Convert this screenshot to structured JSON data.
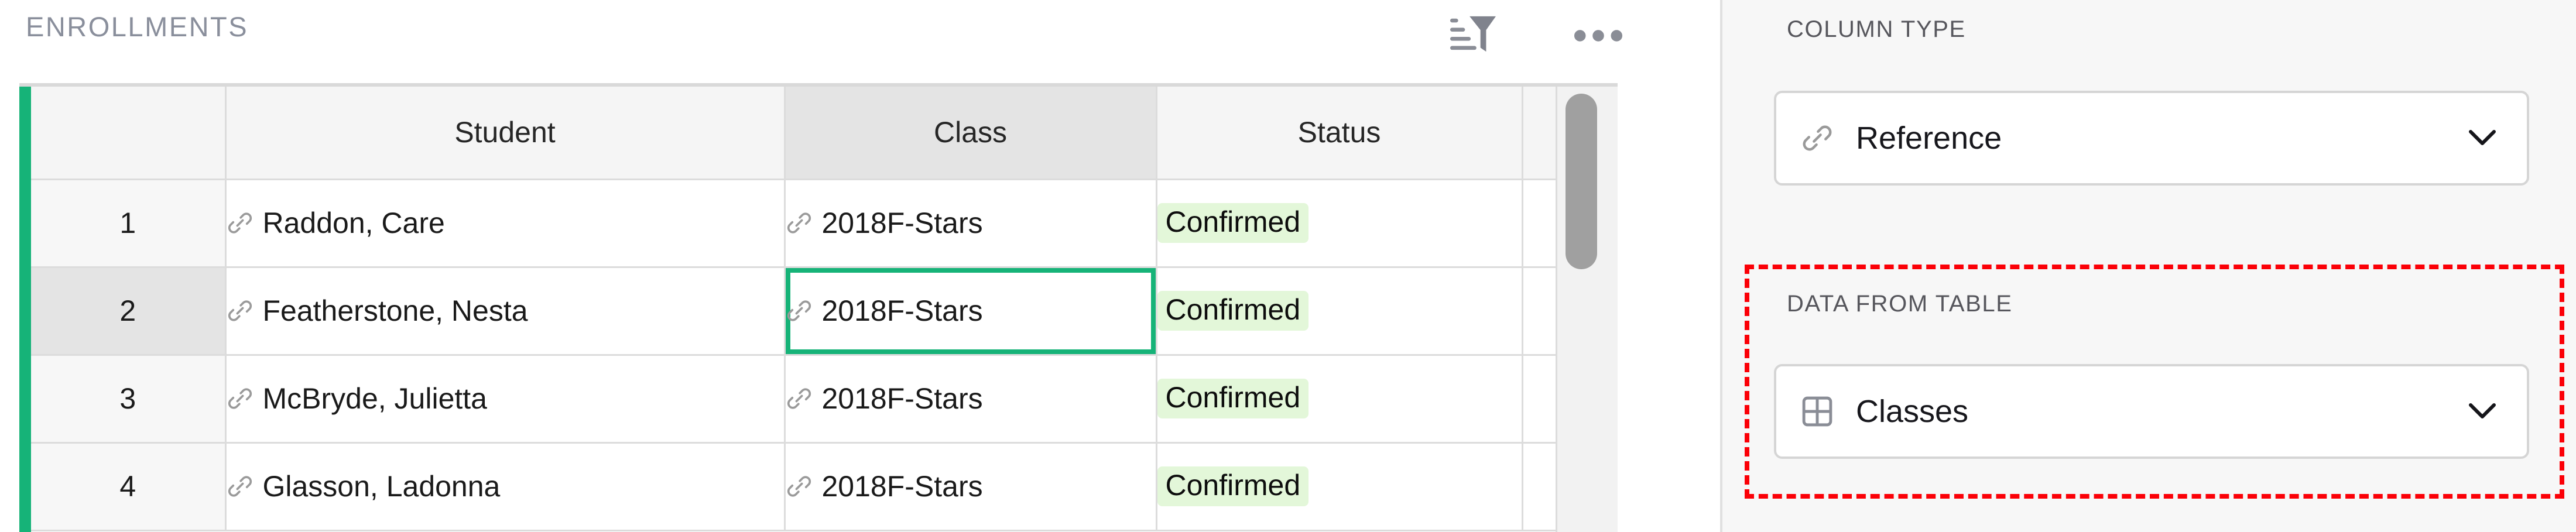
{
  "section": {
    "title": "ENROLLMENTS",
    "tools": [
      {
        "name": "sort-filter-icon",
        "label": "Sort & Filter"
      },
      {
        "name": "more-options-icon",
        "label": "More options"
      }
    ]
  },
  "table": {
    "columns": [
      "",
      "Student",
      "Class",
      "Status",
      ""
    ],
    "selected_column": "Class",
    "active_row": 2,
    "selected_cell": {
      "row": 2,
      "column": "Class"
    },
    "rows": [
      {
        "num": "1",
        "student": "Raddon, Care",
        "class": "2018F-Stars",
        "status": "Confirmed"
      },
      {
        "num": "2",
        "student": "Featherstone, Nesta",
        "class": "2018F-Stars",
        "status": "Confirmed"
      },
      {
        "num": "3",
        "student": "McBryde, Julietta",
        "class": "2018F-Stars",
        "status": "Confirmed"
      },
      {
        "num": "4",
        "student": "Glasson, Ladonna",
        "class": "2018F-Stars",
        "status": "Confirmed"
      }
    ]
  },
  "panel": {
    "column_type": {
      "label": "COLUMN TYPE",
      "value": "Reference",
      "icon": "link-icon"
    },
    "data_from_table": {
      "label": "DATA FROM TABLE",
      "value": "Classes",
      "icon": "table-grid-icon",
      "highlighted": true
    }
  },
  "colors": {
    "accent_green": "#16b378",
    "pill_green": "#e3f7d9",
    "annotation_red": "#fb0007",
    "panel_bg": "#f7f7f7",
    "header_bg": "#f5f5f5",
    "selected_header_bg": "#e4e4e4",
    "title_gray": "#8a8f9c"
  }
}
